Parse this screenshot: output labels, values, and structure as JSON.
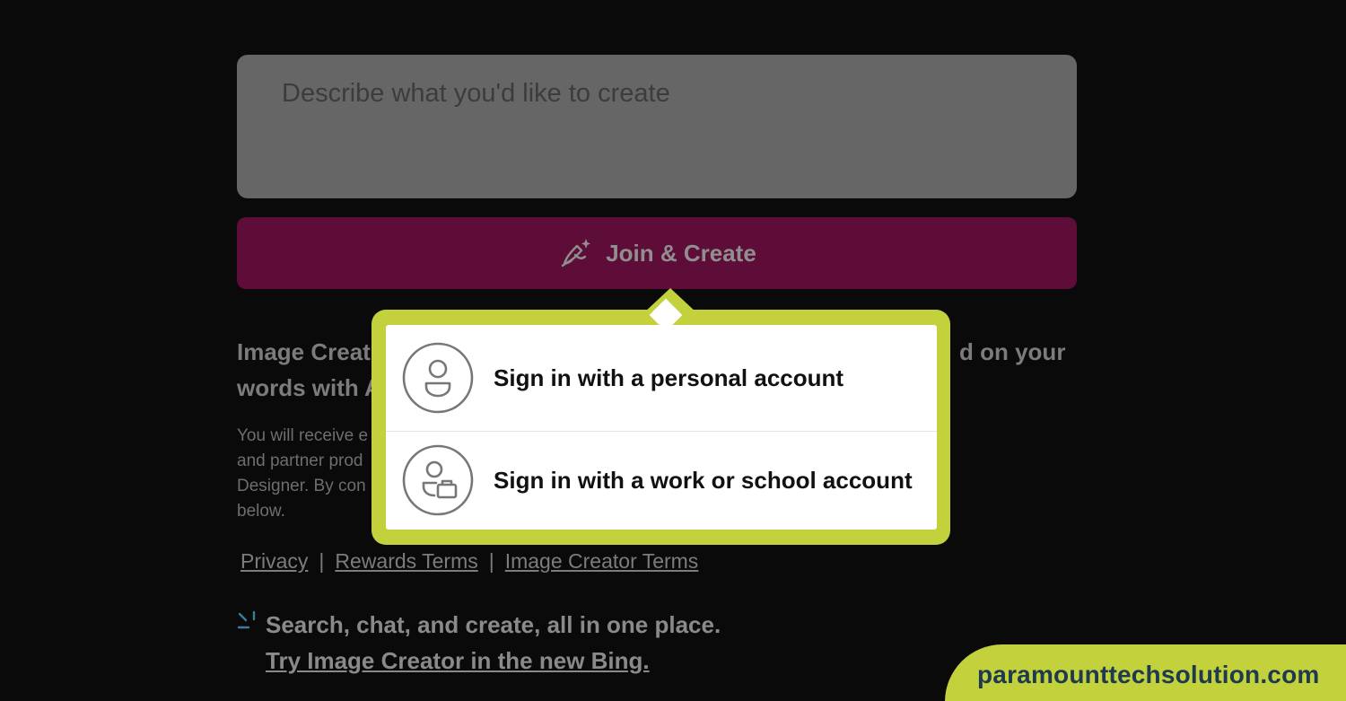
{
  "prompt": {
    "placeholder": "Describe what you'd like to create"
  },
  "join_button": {
    "label": "Join & Create",
    "icon": "pen-sparkle-icon",
    "color": "#5e0c38"
  },
  "description": {
    "heading_start": "Image Creat",
    "heading_line2": "words with A",
    "heading_end": "d on your",
    "small_lines": [
      "You will receive e",
      "and partner prod",
      "Designer. By con",
      "below."
    ]
  },
  "links": [
    {
      "label": "Privacy"
    },
    {
      "label": "Rewards Terms"
    },
    {
      "label": "Image Creator Terms"
    }
  ],
  "link_separator": "|",
  "promo": {
    "icon": "sparkle-icon",
    "text": "Search, chat, and create, all in one place.",
    "link": "Try Image Creator in the new Bing."
  },
  "signin_popup": {
    "border_color": "#c3d13c",
    "options": [
      {
        "label": "Sign in with a personal account",
        "icon": "person-icon"
      },
      {
        "label": "Sign in with a work or school account",
        "icon": "person-briefcase-icon"
      }
    ]
  },
  "watermark": {
    "text": "paramounttechsolution.com",
    "color": "#1d3a4e"
  }
}
